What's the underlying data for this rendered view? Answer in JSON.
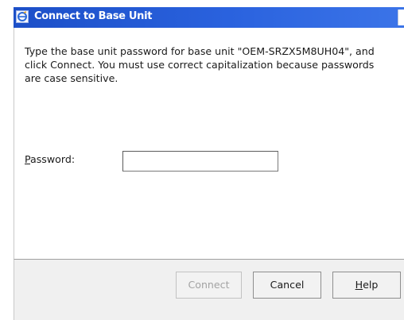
{
  "window": {
    "title": "Connect to Base Unit",
    "icon": "app-icon"
  },
  "dialog": {
    "message": "Type the base unit password for base unit \"OEM-SRZX5M8UH04\", and click Connect. You must use correct capitalization because passwords are case sensitive.",
    "password_label_accel": "P",
    "password_label_rest": "assword:",
    "password_value": ""
  },
  "buttons": {
    "connect": {
      "label": "Connect",
      "enabled": false
    },
    "cancel": {
      "label": "Cancel"
    },
    "help_accel": "H",
    "help_rest": "elp"
  },
  "colors": {
    "titlebar": "#2a62de",
    "footer": "#f0f0f0",
    "disabled_text": "#a3a3a3"
  }
}
